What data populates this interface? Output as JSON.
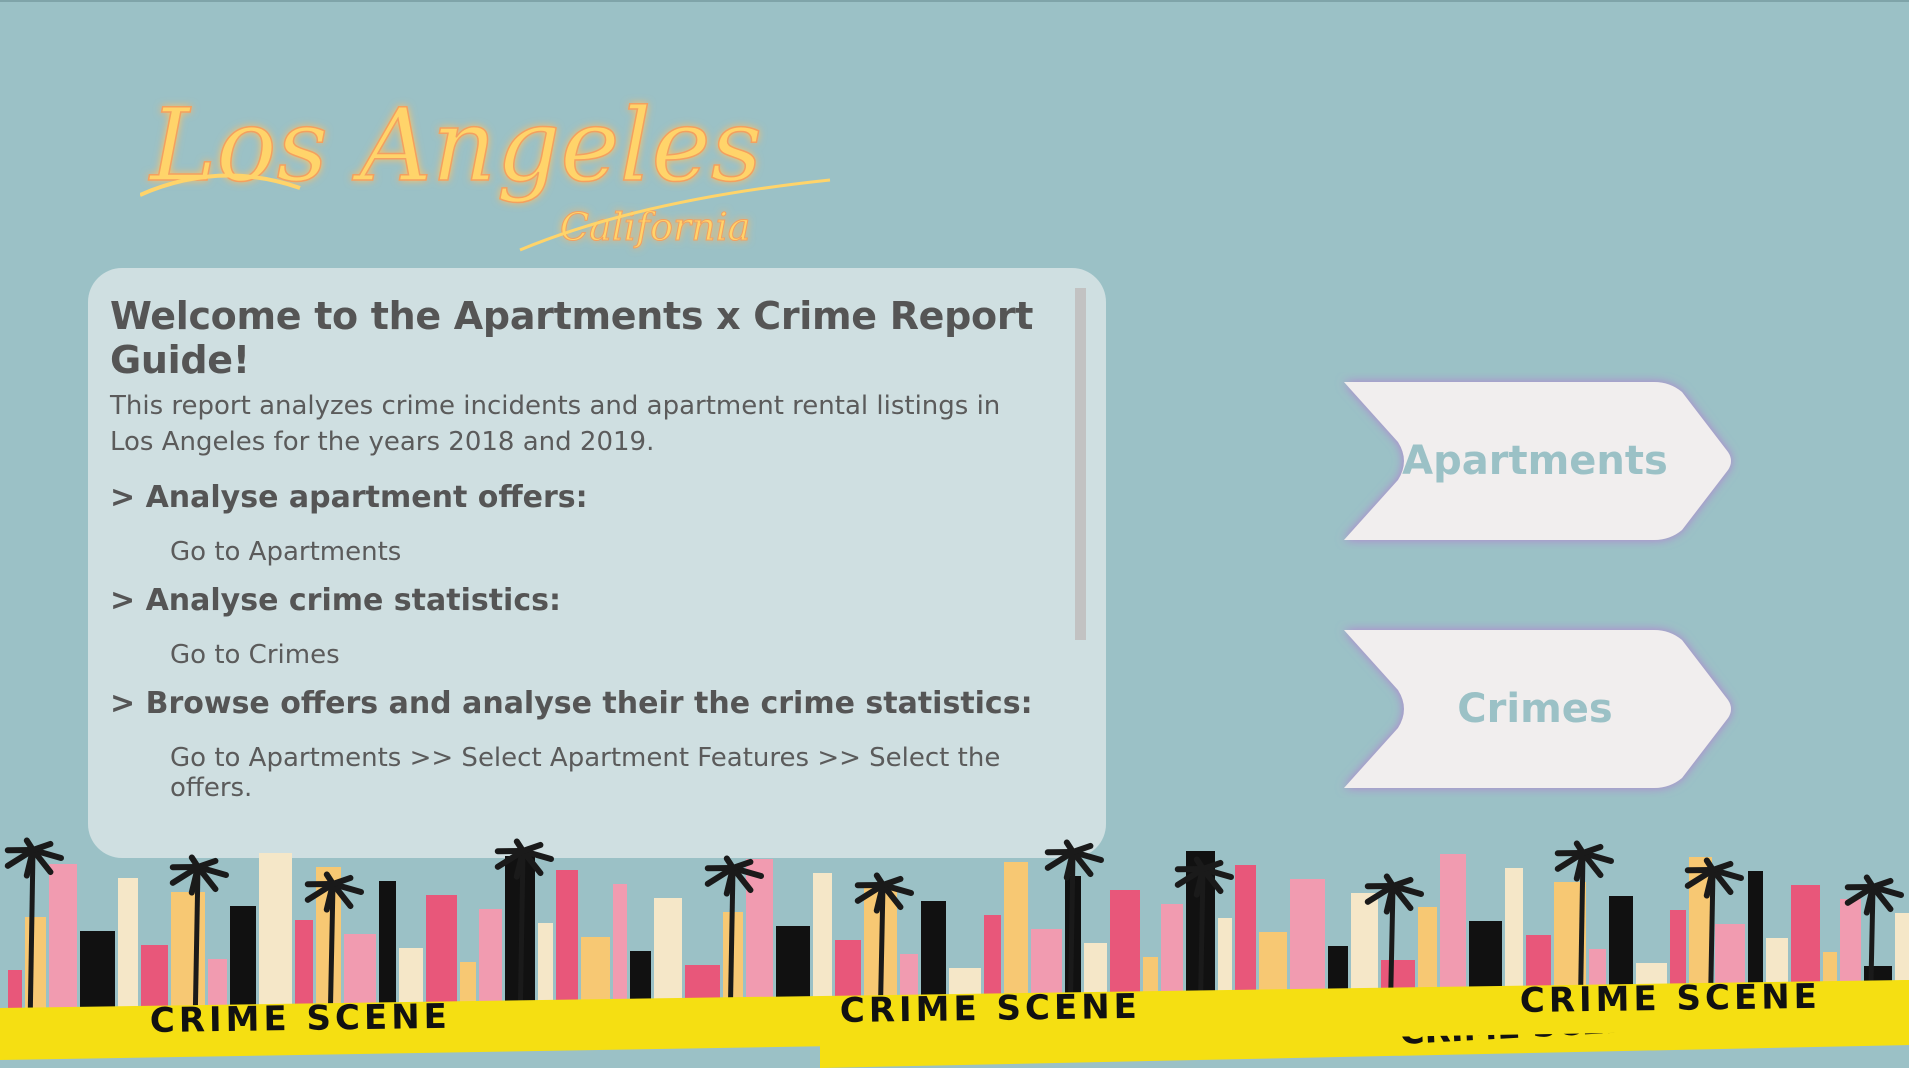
{
  "logo": {
    "main": "Los Angeles",
    "sub": "California"
  },
  "panel": {
    "title": "Welcome to the Apartments x Crime Report Guide!",
    "intro": "This report analyzes crime incidents and apartment rental listings in Los Angeles for the years 2018 and 2019.",
    "sections": [
      {
        "heading": "> Analyse apartment offers:",
        "action": "Go to Apartments"
      },
      {
        "heading": "> Analyse crime statistics:",
        "action": "Go to Crimes"
      },
      {
        "heading": "> Browse offers and analyse their the crime statistics:",
        "action": "Go to Apartments >> Select Apartment Features >> Select the offers."
      }
    ]
  },
  "nav": {
    "apartments_label": "Apartments",
    "crimes_label": "Crimes"
  },
  "tape": {
    "text": "CRIME SCENE"
  },
  "colors": {
    "background": "#9bc1c6",
    "panel": "#cfdfe1",
    "button_fill": "#f1eeee",
    "button_glow": "#b27fd0",
    "logo": "#ffd46a",
    "tape": "#f5df12",
    "skyline_pink": "#e8577a"
  },
  "icons": {
    "logo": "los-angeles-script-logo",
    "skyline": "city-skyline-illustration"
  }
}
